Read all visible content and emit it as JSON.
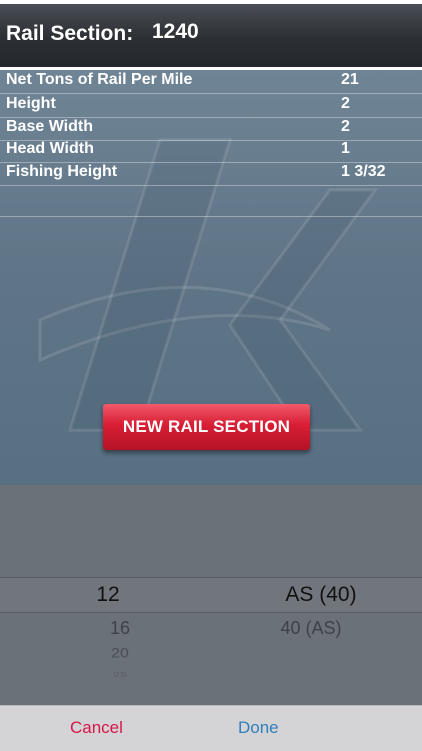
{
  "header": {
    "label": "Rail Section:",
    "value": "1240"
  },
  "specs": [
    {
      "label": "Net Tons of Rail Per Mile",
      "value": "21"
    },
    {
      "label": "Height",
      "value": "2"
    },
    {
      "label": "Base Width",
      "value": "2"
    },
    {
      "label": "Head Width",
      "value": "1"
    },
    {
      "label": "Fishing Height",
      "value": "1 3/32"
    }
  ],
  "new_button_label": "NEW RAIL SECTION",
  "picker": {
    "left_column": {
      "selected": "12",
      "below": [
        "16",
        "20",
        "25"
      ]
    },
    "right_column": {
      "selected": "AS (40)",
      "below": [
        "40 (AS)"
      ]
    }
  },
  "toolbar": {
    "cancel_label": "Cancel",
    "done_label": "Done"
  },
  "colors": {
    "accent_red": "#d81e35",
    "cancel": "#d6164a",
    "done": "#2f7fba"
  }
}
